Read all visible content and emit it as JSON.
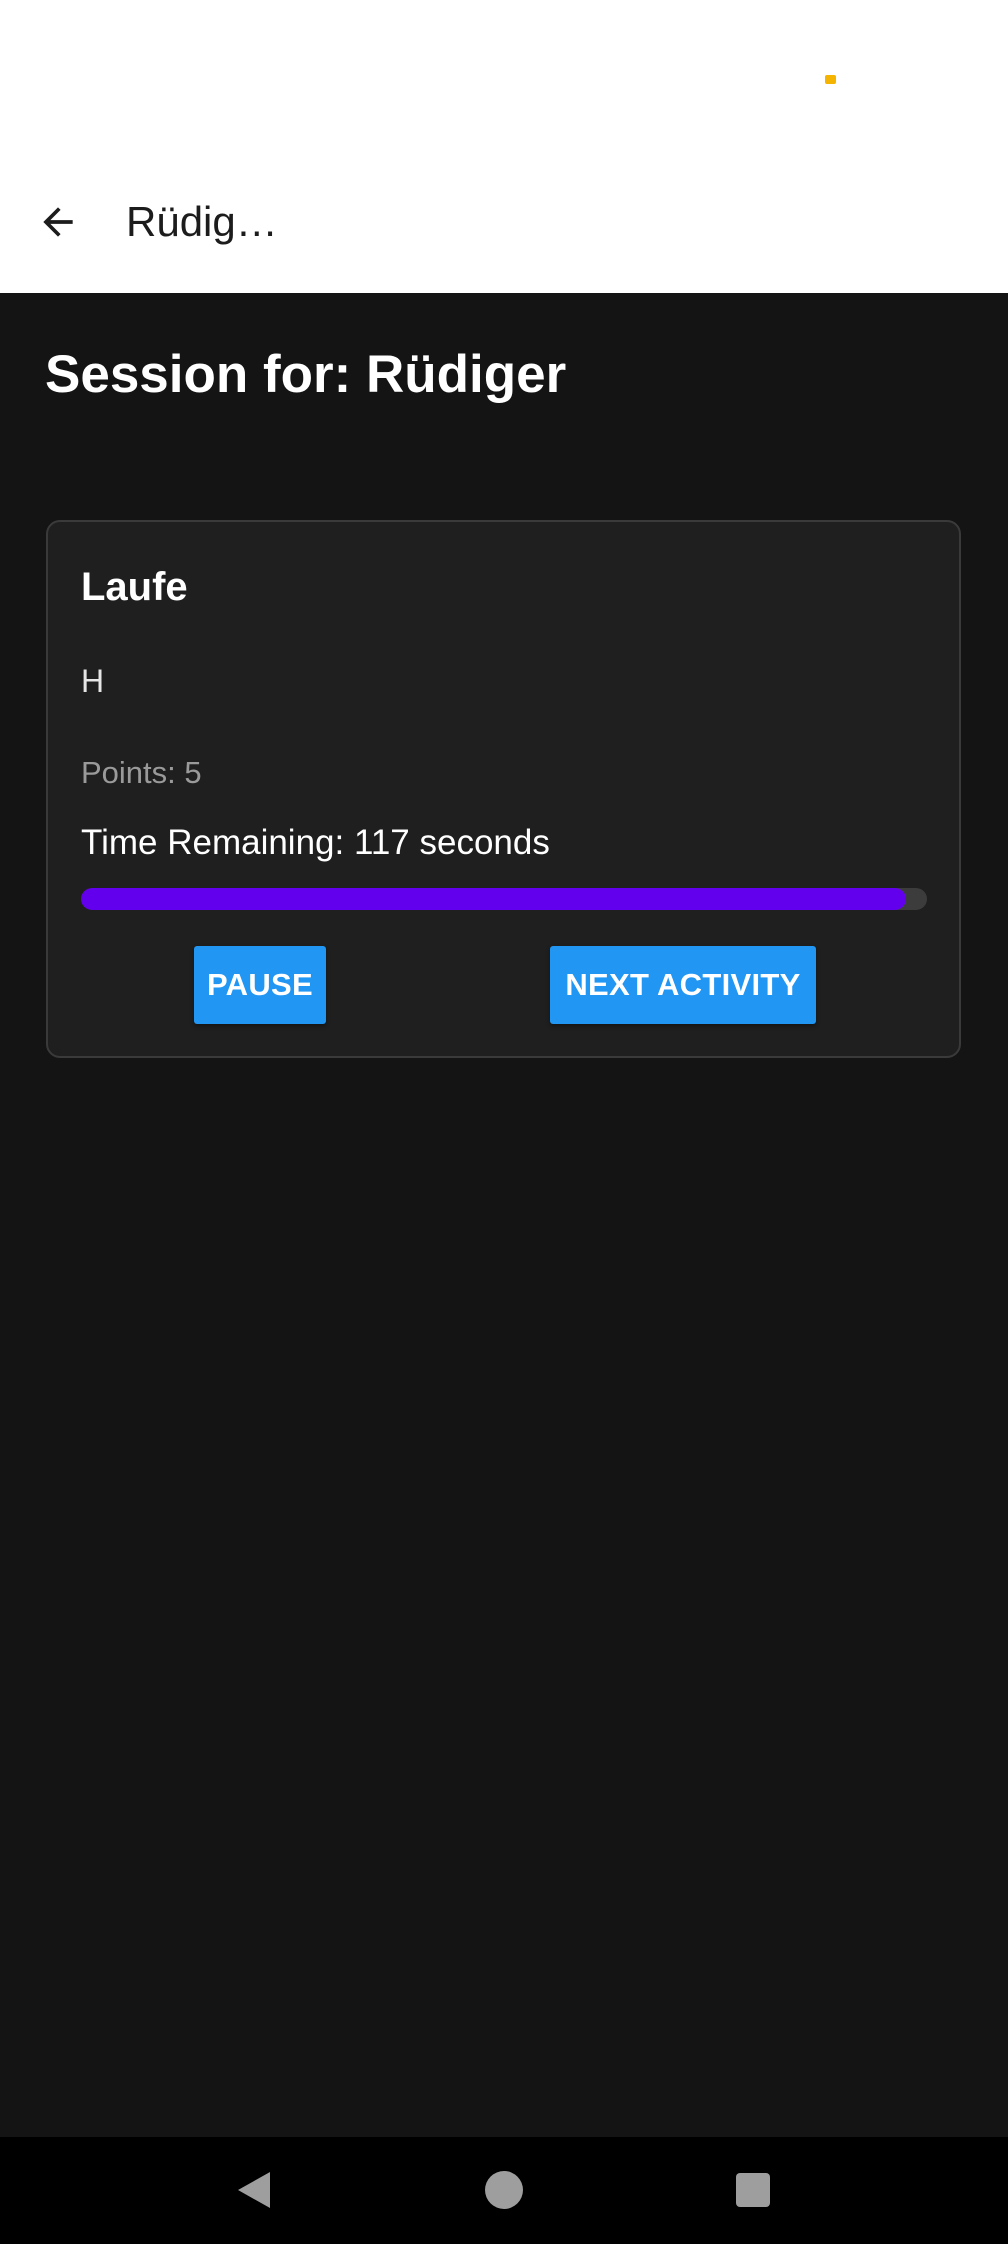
{
  "status_bar": {
    "indicator_color": "#f4b400"
  },
  "app_bar": {
    "back_icon": "arrow-left-icon",
    "title": "Rüdig…"
  },
  "session": {
    "title": "Session for: Rüdiger"
  },
  "activity": {
    "name": "Laufe",
    "description": "H",
    "points_text": "Points: 5",
    "time_remaining_text": "Time Remaining: 117 seconds",
    "progress_fraction": 0.975,
    "progress_color": "#6200ee"
  },
  "buttons": {
    "pause_label": "PAUSE",
    "next_label": "NEXT ACTIVITY",
    "color": "#2196f3"
  },
  "nav_bar": {
    "back_icon": "triangle-back-icon",
    "home_icon": "circle-home-icon",
    "recents_icon": "square-recents-icon"
  }
}
